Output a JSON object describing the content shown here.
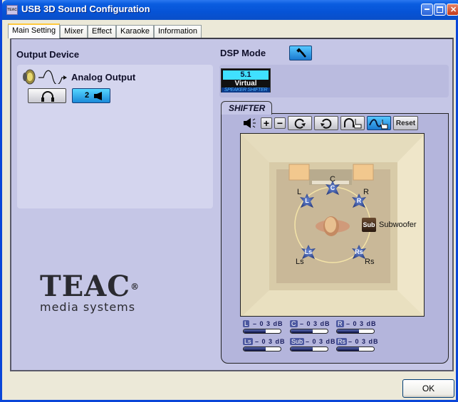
{
  "window": {
    "title": "USB 3D Sound Configuration",
    "icon_text": "TEAC",
    "controls": [
      "minimize",
      "maximize",
      "close"
    ]
  },
  "tabs": [
    {
      "label": "Main Setting",
      "active": true
    },
    {
      "label": "Mixer",
      "active": false
    },
    {
      "label": "Effect",
      "active": false
    },
    {
      "label": "Karaoke",
      "active": false
    },
    {
      "label": "Information",
      "active": false
    }
  ],
  "output_device": {
    "title": "Output Device",
    "analog_label": "Analog Output",
    "headphone_selected": false,
    "speaker_button_label": "2",
    "speaker_selected": true
  },
  "logo": {
    "brand": "TEAC",
    "registered": "®",
    "tagline": "media systems"
  },
  "dsp": {
    "title": "DSP Mode",
    "mode_badge": {
      "line1": "5.1",
      "line2": "Virtual",
      "line3": "SPEAKER SHIFTER"
    }
  },
  "shifter": {
    "tab_label": "SHIFTER",
    "toolbar": {
      "volume_icon": "speaker-icon",
      "plus": "+",
      "minus": "−",
      "rotate_cw": "rotate-clockwise",
      "rotate_ccw": "rotate-counterclockwise",
      "headphone_hand": "headphone-pointer",
      "wave_hand": "wave-pointer",
      "wave_active": true,
      "reset_label": "Reset"
    },
    "speakers": [
      {
        "id": "C",
        "label": "C",
        "badge": "C"
      },
      {
        "id": "L",
        "label": "L",
        "badge": "L"
      },
      {
        "id": "R",
        "label": "R",
        "badge": "R"
      },
      {
        "id": "Ls",
        "label": "Ls",
        "badge": "Ls"
      },
      {
        "id": "Rs",
        "label": "Rs",
        "badge": "Rs"
      },
      {
        "id": "Sub",
        "label": "Subwoofer",
        "badge": "Sub"
      }
    ],
    "levels": [
      {
        "tag": "L",
        "value": "– 0 3 dB",
        "fill": 0.6
      },
      {
        "tag": "C",
        "value": "– 0 3 dB",
        "fill": 0.6
      },
      {
        "tag": "R",
        "value": "– 0 3 dB",
        "fill": 0.6
      },
      {
        "tag": "Ls",
        "value": "– 0 3 dB",
        "fill": 0.6
      },
      {
        "tag": "Sub",
        "value": "– 0 3 dB",
        "fill": 0.6
      },
      {
        "tag": "Rs",
        "value": "– 0 3 dB",
        "fill": 0.6
      }
    ]
  },
  "footer": {
    "ok_label": "OK"
  },
  "colors": {
    "accent": "#1a8ad8",
    "panel": "#c5c6e6",
    "title_bar": "#0653d6"
  }
}
